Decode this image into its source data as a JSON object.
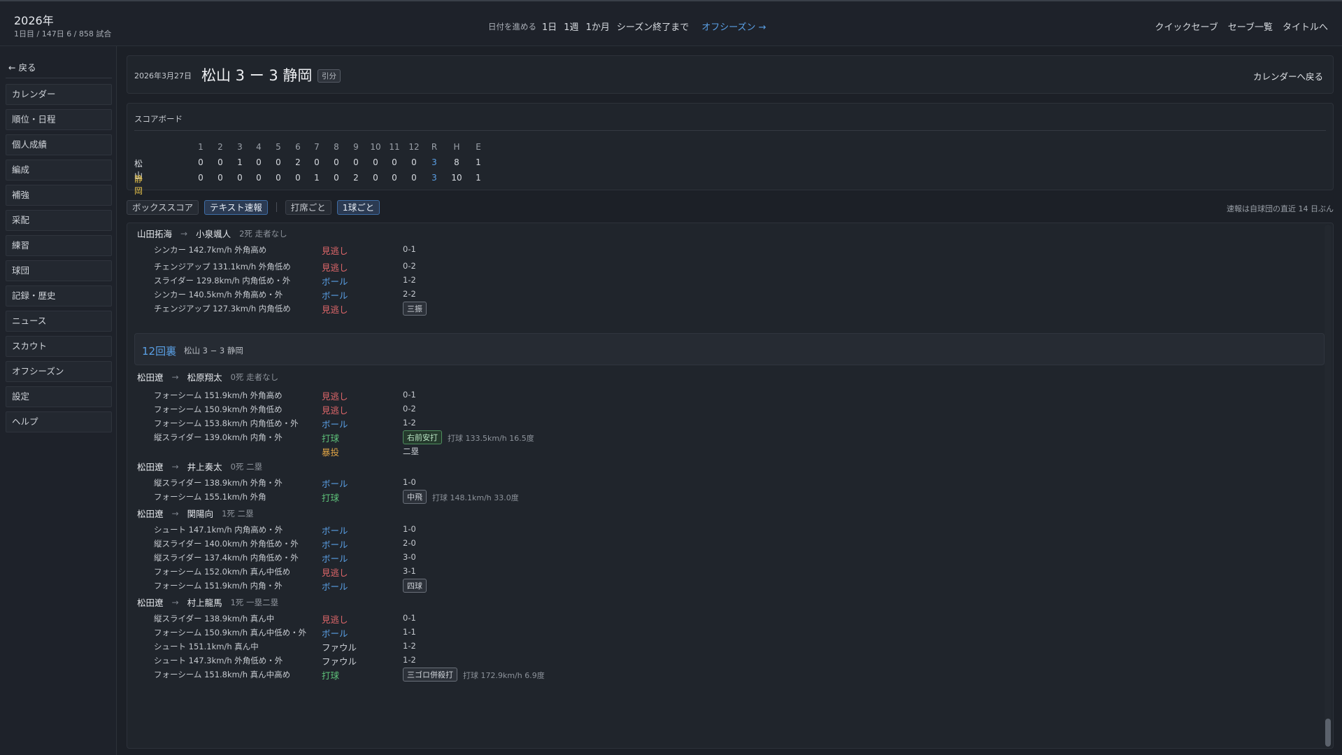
{
  "header": {
    "season": "2026年",
    "progress": "1日目 / 147日  6 / 858 試合",
    "advance_label": "日付を進める",
    "advance_buttons": [
      "1日",
      "1週",
      "1か月",
      "シーズン終了まで"
    ],
    "offseason_link": "オフシーズン →",
    "right_buttons": [
      "クイックセーブ",
      "セーブ一覧",
      "タイトルへ"
    ]
  },
  "sidebar": {
    "back": "← 戻る",
    "items": [
      "カレンダー",
      "順位・日程",
      "個人成績",
      "編成",
      "補強",
      "采配",
      "練習",
      "球団",
      "記録・歴史",
      "ニュース",
      "スカウト",
      "オフシーズン",
      "設定",
      "ヘルプ"
    ]
  },
  "match": {
    "date": "2026年3月27日",
    "score": "松山 3 ー 3 静岡",
    "result": "引分",
    "back_to_calendar": "カレンダーへ戻る"
  },
  "scoreboard": {
    "title": "スコアボード",
    "columns": [
      "1",
      "2",
      "3",
      "4",
      "5",
      "6",
      "7",
      "8",
      "9",
      "10",
      "11",
      "12",
      "R",
      "H",
      "E"
    ],
    "rows": [
      {
        "team": "松山",
        "team_color": "#d7dbe0",
        "cells": [
          "0",
          "0",
          "1",
          "0",
          "0",
          "2",
          "0",
          "0",
          "0",
          "0",
          "0",
          "0",
          "3",
          "8",
          "1"
        ]
      },
      {
        "team": "静岡",
        "team_color": "#e8c34a",
        "cells": [
          "0",
          "0",
          "0",
          "0",
          "0",
          "0",
          "1",
          "0",
          "2",
          "0",
          "0",
          "0",
          "3",
          "10",
          "1"
        ]
      }
    ]
  },
  "tabs": {
    "items": [
      "ボックススコア",
      "テキスト速報"
    ],
    "sub_items": [
      "打席ごと",
      "1球ごと"
    ],
    "note": "速報は自球団の直近 14 日ぶん"
  },
  "log": {
    "inning": {
      "title": "12回裏",
      "score": "松山 3 − 3 静岡"
    },
    "at_bats": [
      {
        "pitcher": "山田拓海",
        "batter": "小泉颯人",
        "situation": "2死 走者なし",
        "pitches": [
          {
            "desc": "シンカー 142.7km/h 外角高め",
            "result": "見逃し",
            "type": "strike",
            "count": "0-1"
          },
          {
            "desc": "チェンジアップ 131.1km/h 外角低め",
            "result": "見逃し",
            "type": "strike",
            "count": "0-2"
          },
          {
            "desc": "スライダー 129.8km/h 内角低め・外",
            "result": "ボール",
            "type": "ball",
            "count": "1-2"
          },
          {
            "desc": "シンカー 140.5km/h 外角高め・外",
            "result": "ボール",
            "type": "ball",
            "count": "2-2"
          },
          {
            "desc": "チェンジアップ 127.3km/h 内角低め",
            "result": "見逃し",
            "type": "strike",
            "count": "",
            "badge": "三振"
          }
        ]
      },
      {
        "pitcher": "松田遼",
        "batter": "松原翔太",
        "situation": "0死 走者なし",
        "pitches": [
          {
            "desc": "フォーシーム 151.9km/h 外角高め",
            "result": "見逃し",
            "type": "strike",
            "count": "0-1"
          },
          {
            "desc": "フォーシーム 150.9km/h 外角低め",
            "result": "見逃し",
            "type": "strike",
            "count": "0-2"
          },
          {
            "desc": "フォーシーム 153.8km/h 内角低め・外",
            "result": "ボール",
            "type": "ball",
            "count": "1-2"
          },
          {
            "desc": "縦スライダー 139.0km/h 内角・外",
            "result": "打球",
            "type": "hit",
            "count": "",
            "badge": "右前安打",
            "badge_green": true,
            "extra": "打球 133.5km/h  16.5度"
          },
          {
            "desc": "",
            "result": "暴投",
            "type": "wild",
            "count": "二塁"
          }
        ]
      },
      {
        "pitcher": "松田遼",
        "batter": "井上奏太",
        "situation": "0死 二塁",
        "pitches": [
          {
            "desc": "縦スライダー 138.9km/h 外角・外",
            "result": "ボール",
            "type": "ball",
            "count": "1-0"
          },
          {
            "desc": "フォーシーム 155.1km/h 外角",
            "result": "打球",
            "type": "hit",
            "count": "",
            "badge": "中飛",
            "extra": "打球 148.1km/h  33.0度"
          }
        ]
      },
      {
        "pitcher": "松田遼",
        "batter": "関陽向",
        "situation": "1死 二塁",
        "pitches": [
          {
            "desc": "シュート 147.1km/h 内角高め・外",
            "result": "ボール",
            "type": "ball",
            "count": "1-0"
          },
          {
            "desc": "縦スライダー 140.0km/h 外角低め・外",
            "result": "ボール",
            "type": "ball",
            "count": "2-0"
          },
          {
            "desc": "縦スライダー 137.4km/h 内角低め・外",
            "result": "ボール",
            "type": "ball",
            "count": "3-0"
          },
          {
            "desc": "フォーシーム 152.0km/h 真ん中低め",
            "result": "見逃し",
            "type": "strike",
            "count": "3-1"
          },
          {
            "desc": "フォーシーム 151.9km/h 内角・外",
            "result": "ボール",
            "type": "ball",
            "count": "",
            "badge": "四球"
          }
        ]
      },
      {
        "pitcher": "松田遼",
        "batter": "村上龍馬",
        "situation": "1死 一塁二塁",
        "pitches": [
          {
            "desc": "縦スライダー 138.9km/h 真ん中",
            "result": "見逃し",
            "type": "strike",
            "count": "0-1"
          },
          {
            "desc": "フォーシーム 150.9km/h 真ん中低め・外",
            "result": "ボール",
            "type": "ball",
            "count": "1-1"
          },
          {
            "desc": "シュート 151.1km/h 真ん中",
            "result": "ファウル",
            "type": "foul",
            "count": "1-2"
          },
          {
            "desc": "シュート 147.3km/h 外角低め・外",
            "result": "ファウル",
            "type": "foul",
            "count": "1-2"
          },
          {
            "desc": "フォーシーム 151.8km/h 真ん中高め",
            "result": "打球",
            "type": "hit",
            "count": "",
            "badge": "三ゴロ併殺打",
            "extra": "打球 172.9km/h  6.9度"
          }
        ]
      }
    ]
  }
}
